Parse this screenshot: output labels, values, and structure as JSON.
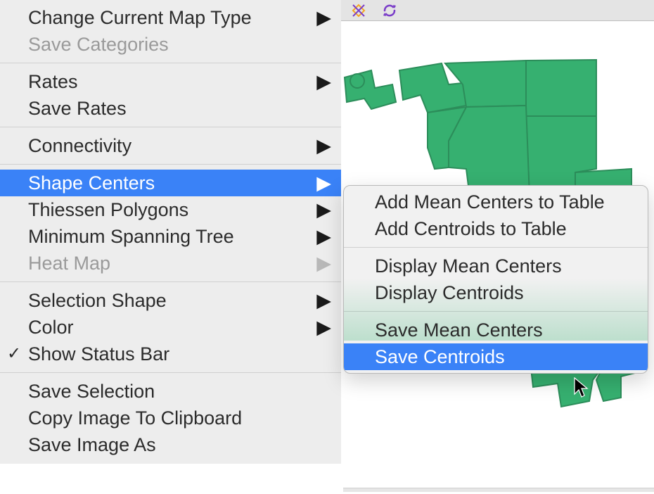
{
  "toolbar_icons": [
    "shape-icon",
    "refresh-icon"
  ],
  "menu": {
    "groups": [
      [
        {
          "label": "Change Current Map Type",
          "submenu": true,
          "disabled": false
        },
        {
          "label": "Save Categories",
          "submenu": false,
          "disabled": true
        }
      ],
      [
        {
          "label": "Rates",
          "submenu": true,
          "disabled": false
        },
        {
          "label": "Save Rates",
          "submenu": false,
          "disabled": false
        }
      ],
      [
        {
          "label": "Connectivity",
          "submenu": true,
          "disabled": false
        }
      ],
      [
        {
          "label": "Shape Centers",
          "submenu": true,
          "selected": true,
          "disabled": false
        },
        {
          "label": "Thiessen Polygons",
          "submenu": true,
          "disabled": false
        },
        {
          "label": "Minimum Spanning Tree",
          "submenu": true,
          "disabled": false
        },
        {
          "label": "Heat Map",
          "submenu": true,
          "disabled": true
        }
      ],
      [
        {
          "label": "Selection Shape",
          "submenu": true,
          "disabled": false
        },
        {
          "label": "Color",
          "submenu": true,
          "disabled": false
        },
        {
          "label": "Show Status Bar",
          "submenu": false,
          "checked": true,
          "disabled": false
        }
      ],
      [
        {
          "label": "Save Selection",
          "submenu": false,
          "disabled": false
        },
        {
          "label": "Copy Image To Clipboard",
          "submenu": false,
          "disabled": false
        },
        {
          "label": "Save Image As",
          "submenu": false,
          "disabled": false
        }
      ]
    ]
  },
  "submenu": {
    "groups": [
      [
        {
          "label": "Add Mean Centers to Table"
        },
        {
          "label": "Add Centroids to Table"
        }
      ],
      [
        {
          "label": "Display Mean Centers"
        },
        {
          "label": "Display Centroids"
        }
      ],
      [
        {
          "label": "Save Mean Centers"
        },
        {
          "label": "Save Centroids",
          "selected": true
        }
      ]
    ]
  },
  "colors": {
    "menu_highlight": "#3a82f7",
    "map_fill": "#36b070",
    "map_stroke": "#2c8d5a"
  }
}
